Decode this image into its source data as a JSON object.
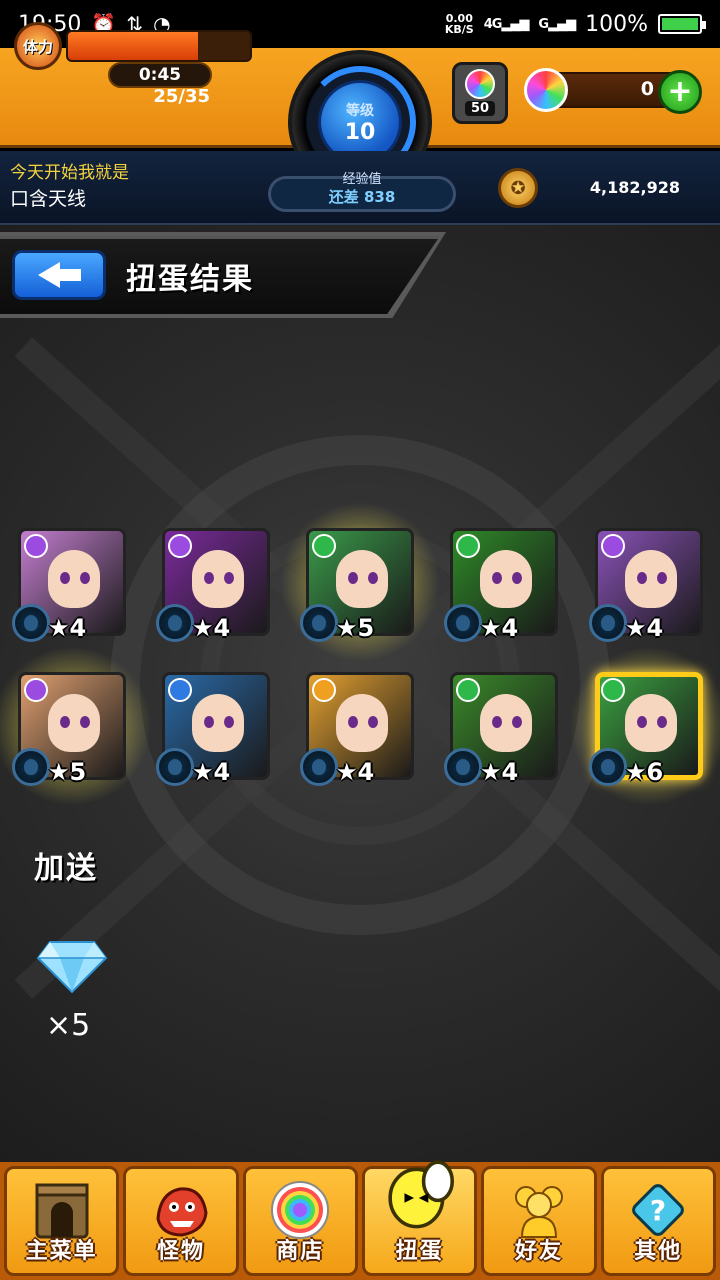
{
  "status_bar": {
    "time": "19:50",
    "net_speed": "0.00",
    "net_unit": "KB/S",
    "sim1": "4G",
    "sim2": "G",
    "battery": "100%"
  },
  "hud": {
    "stamina_label": "体力",
    "stamina_timer": "0:45",
    "stamina_value": "25/35",
    "stamina_fraction": 0.714,
    "level_label": "等级",
    "level_value": "10",
    "exp_label": "经验值",
    "exp_remaining": "还差 838",
    "orb_count": "50",
    "gem_count": "0",
    "coins": "4,182,928",
    "motto": "今天开始我就是",
    "player_name": "口含天线"
  },
  "header": {
    "title": "扭蛋结果"
  },
  "results": [
    {
      "rarity": "★4",
      "attr_color": "#9b4be0",
      "bg": "#c47fd0",
      "glow": false,
      "gold": false
    },
    {
      "rarity": "★4",
      "attr_color": "#9b4be0",
      "bg": "#7b2a9c",
      "glow": false,
      "gold": false
    },
    {
      "rarity": "★5",
      "attr_color": "#2fb84a",
      "bg": "#3a9a4a",
      "glow": true,
      "gold": false
    },
    {
      "rarity": "★4",
      "attr_color": "#2fb84a",
      "bg": "#2e8a28",
      "glow": false,
      "gold": false
    },
    {
      "rarity": "★4",
      "attr_color": "#9b4be0",
      "bg": "#8a52b8",
      "glow": false,
      "gold": false
    },
    {
      "rarity": "★5",
      "attr_color": "#9b4be0",
      "bg": "#e0a070",
      "glow": true,
      "gold": false
    },
    {
      "rarity": "★4",
      "attr_color": "#2e7ae0",
      "bg": "#2a6aa8",
      "glow": false,
      "gold": false
    },
    {
      "rarity": "★4",
      "attr_color": "#f0a020",
      "bg": "#e3a030",
      "glow": false,
      "gold": false
    },
    {
      "rarity": "★4",
      "attr_color": "#2fb84a",
      "bg": "#3a8a2a",
      "glow": false,
      "gold": false
    },
    {
      "rarity": "★6",
      "attr_color": "#2fb84a",
      "bg": "#3aa040",
      "glow": true,
      "gold": true
    }
  ],
  "bonus": {
    "label": "加送",
    "icon": "diamond-icon",
    "quantity": "×5"
  },
  "nav": [
    {
      "label": "主菜单",
      "icon": "castle-icon"
    },
    {
      "label": "怪物",
      "icon": "dragon-icon"
    },
    {
      "label": "商店",
      "icon": "rainbow-orb-icon"
    },
    {
      "label": "扭蛋",
      "icon": "gacha-egg-icon"
    },
    {
      "label": "好友",
      "icon": "friends-icon"
    },
    {
      "label": "其他",
      "icon": "question-icon"
    }
  ],
  "colors": {
    "hud_orange": "#f7a521",
    "nav_orange": "#f09a12",
    "level_blue": "#1356c4",
    "gem_add_green": "#1e9a18",
    "motto_yellow": "#f6d33c"
  }
}
